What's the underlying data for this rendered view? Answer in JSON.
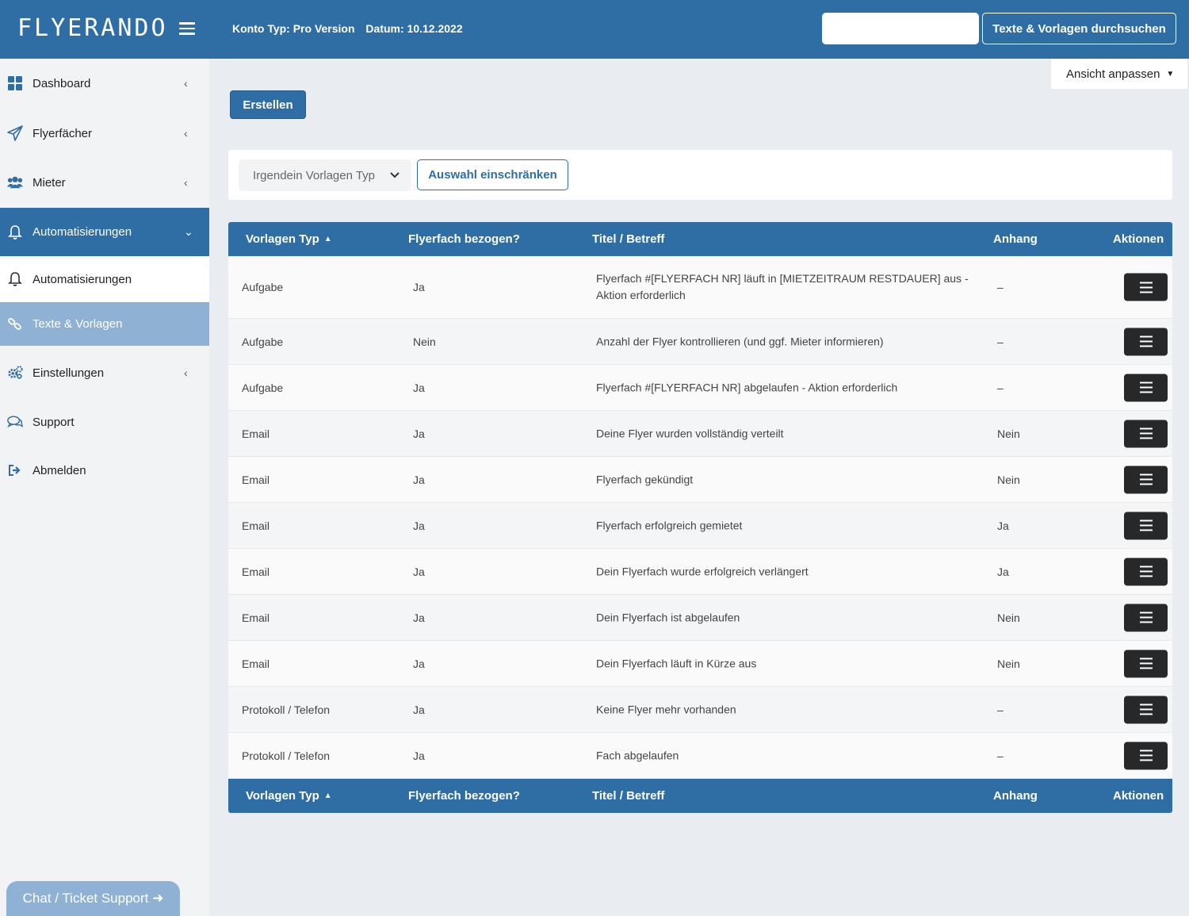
{
  "header": {
    "logo": "FLYERANDO",
    "konto": "Konto Typ: Pro Version",
    "datum": "Datum: 10.12.2022",
    "search_value": "",
    "search_button": "Texte & Vorlagen durchsuchen"
  },
  "sidebar": {
    "items": [
      {
        "label": "Dashboard",
        "icon": "dashboard-icon"
      },
      {
        "label": "Flyerfächer",
        "icon": "paper-plane-icon"
      },
      {
        "label": "Mieter",
        "icon": "users-icon"
      },
      {
        "label": "Automatisierungen",
        "icon": "bell-icon"
      },
      {
        "label": "Automatisierungen",
        "icon": "bell-icon"
      },
      {
        "label": "Texte & Vorlagen",
        "icon": "link-icon"
      },
      {
        "label": "Einstellungen",
        "icon": "gears-icon"
      },
      {
        "label": "Support",
        "icon": "chat-icon"
      },
      {
        "label": "Abmelden",
        "icon": "logout-icon"
      }
    ],
    "chat_button": "Chat / Ticket Support ➜"
  },
  "toolbar": {
    "view_label": "Ansicht anpassen",
    "create_label": "Erstellen"
  },
  "filter": {
    "select_value": "Irgendein Vorlagen Typ",
    "apply_label": "Auswahl einschränken"
  },
  "table": {
    "columns": [
      "Vorlagen Typ",
      "Flyerfach bezogen?",
      "Titel / Betreff",
      "Anhang",
      "Aktionen"
    ],
    "rows": [
      {
        "typ": "Aufgabe",
        "bezogen": "Ja",
        "titel": "Flyerfach #[FLYERFACH NR] läuft in [MIETZEITRAUM RESTDAUER] aus - Aktion erforderlich",
        "anhang": "–"
      },
      {
        "typ": "Aufgabe",
        "bezogen": "Nein",
        "titel": "Anzahl der Flyer kontrollieren (und ggf. Mieter informieren)",
        "anhang": "–"
      },
      {
        "typ": "Aufgabe",
        "bezogen": "Ja",
        "titel": "Flyerfach #[FLYERFACH NR] abgelaufen - Aktion erforderlich",
        "anhang": "–"
      },
      {
        "typ": "Email",
        "bezogen": "Ja",
        "titel": "Deine Flyer wurden vollständig verteilt",
        "anhang": "Nein"
      },
      {
        "typ": "Email",
        "bezogen": "Ja",
        "titel": "Flyerfach gekündigt",
        "anhang": "Nein"
      },
      {
        "typ": "Email",
        "bezogen": "Ja",
        "titel": "Flyerfach erfolgreich gemietet",
        "anhang": "Ja"
      },
      {
        "typ": "Email",
        "bezogen": "Ja",
        "titel": "Dein Flyerfach wurde erfolgreich verlängert",
        "anhang": "Ja"
      },
      {
        "typ": "Email",
        "bezogen": "Ja",
        "titel": "Dein Flyerfach ist abgelaufen",
        "anhang": "Nein"
      },
      {
        "typ": "Email",
        "bezogen": "Ja",
        "titel": "Dein Flyerfach läuft in Kürze aus",
        "anhang": "Nein"
      },
      {
        "typ": "Protokoll / Telefon",
        "bezogen": "Ja",
        "titel": "Keine Flyer mehr vorhanden",
        "anhang": "–"
      },
      {
        "typ": "Protokoll / Telefon",
        "bezogen": "Ja",
        "titel": "Fach abgelaufen",
        "anhang": "–"
      }
    ]
  },
  "colors": {
    "primary": "#2f6ea4",
    "sidebar_selected": "#8fb1d3",
    "action_button": "#262829"
  }
}
